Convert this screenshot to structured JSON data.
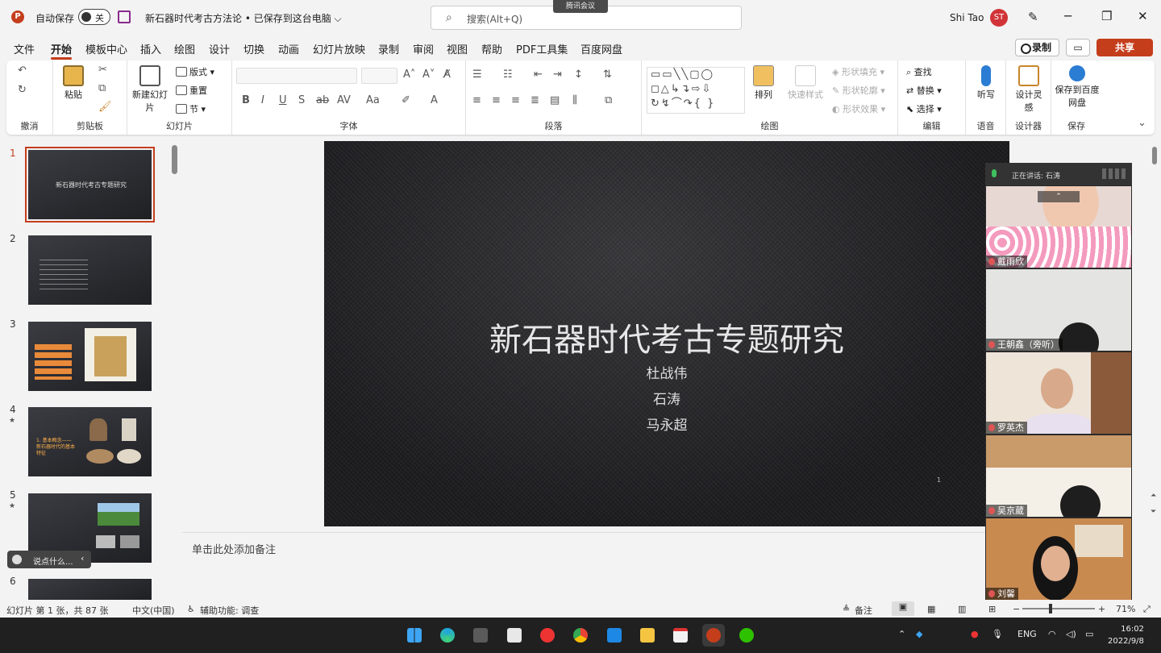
{
  "titlebar": {
    "autosave_label": "自动保存",
    "autosave_state": "关",
    "doc_title": "新石器时代考古方法论 • 已保存到这台电脑 ⌵",
    "search_placeholder": "搜索(Alt+Q)",
    "meeting_tag": "腾讯会议",
    "user_name": "Shi Tao",
    "user_initials": "ST"
  },
  "menu": {
    "tabs": [
      "文件",
      "开始",
      "模板中心",
      "插入",
      "绘图",
      "设计",
      "切换",
      "动画",
      "幻灯片放映",
      "录制",
      "审阅",
      "视图",
      "帮助",
      "PDF工具集",
      "百度网盘"
    ],
    "active_index": 1,
    "record_label": "录制",
    "share_label": "共享"
  },
  "ribbon": {
    "groups": [
      "撤消",
      "剪贴板",
      "幻灯片",
      "字体",
      "段落",
      "绘图",
      "编辑",
      "语音",
      "设计器",
      "保存"
    ],
    "paste": "粘贴",
    "new_slide": "新建幻灯片",
    "layout": "版式",
    "reset": "重置",
    "section": "节",
    "arrange": "排列",
    "quick_styles": "快速样式",
    "shape_fill": "形状填充",
    "shape_outline": "形状轮廓",
    "shape_effects": "形状效果",
    "find": "查找",
    "replace": "替换",
    "select": "选择",
    "dictate": "听写",
    "designer": "设计灵感",
    "save_baidu": "保存到百度网盘"
  },
  "slides_panel": {
    "numbers": [
      "1",
      "2",
      "3",
      "4",
      "5",
      "6"
    ],
    "thumb1_title": "新石器时代考古专题研究",
    "thumb4_text": "1. 基本概念——新石器时代的基本特征",
    "chat_pill": "说点什么..."
  },
  "current_slide": {
    "title": "新石器时代考古专题研究",
    "authors": [
      "杜战伟",
      "石涛",
      "马永超"
    ],
    "page_number": "1"
  },
  "notes_placeholder": "单击此处添加备注",
  "meeting": {
    "speaking_label": "正在讲话: 石涛",
    "participants": [
      "戴雨欣",
      "王朝鑫（旁听）",
      "罗英杰",
      "吴京葳",
      "刘馨"
    ]
  },
  "statusbar": {
    "slide_info": "幻灯片 第 1 张，共 87 张",
    "language": "中文(中国)",
    "accessibility": "辅助功能: 调查",
    "notes_btn": "备注",
    "zoom": "71%"
  },
  "taskbar": {
    "lang": "ENG",
    "time": "16:02",
    "date": "2022/9/8"
  },
  "colors": {
    "accent": "#c43e1c",
    "slide_bg": "#232326"
  }
}
